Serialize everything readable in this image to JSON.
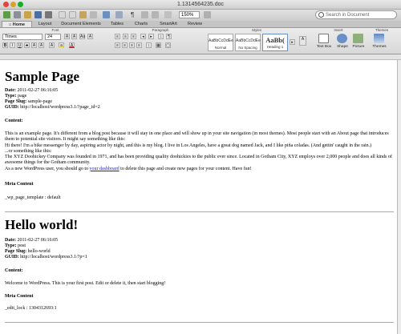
{
  "window": {
    "title": "1.1314564235.doc"
  },
  "toolbar": {
    "zoom": "150%",
    "search_placeholder": "Search in Document"
  },
  "tabs": [
    "Home",
    "Layout",
    "Document Elements",
    "Tables",
    "Charts",
    "SmartArt",
    "Review"
  ],
  "ribbon": {
    "groups": {
      "font": "Font",
      "paragraph": "Paragraph",
      "styles": "Styles",
      "insert": "Insert",
      "themes": "Themes"
    },
    "font_name": "Times",
    "font_size": "24",
    "style_items": [
      {
        "sample": "AaBbCcDdEe",
        "name": "Normal"
      },
      {
        "sample": "AaBbCcDdEe",
        "name": "No Spacing"
      },
      {
        "sample": "AaBb(",
        "name": "Heading 1"
      }
    ],
    "insert_items": [
      "Text Box",
      "Shape",
      "Picture"
    ],
    "themes_label": "Themes"
  },
  "document": {
    "post1": {
      "title": "Sample Page",
      "date_label": "Date:",
      "date": "2011-02-27 06:16:05",
      "type_label": "Type:",
      "type": "page",
      "slug_label": "Page Slug:",
      "slug": "sample-page",
      "guid_label": "GUID:",
      "guid": "http://localhost/wordpress3.1/?page_id=2",
      "content_label": "Content:",
      "p1": "This is an example page. It's different from a blog post because it will stay in one place and will show up in your site navigation (in most themes). Most people start with an About page that introduces them to potential site visitors. It might say something like this:",
      "p2": "Hi there! I'm a bike messenger by day, aspiring actor by night, and this is my blog. I live in Los Angeles, have a great dog named Jack, and I like piña coladas. (And gettin' caught in the rain.)",
      "p3": "...or something like this:",
      "p4": "The XYZ Doohickey Company was founded in 1971, and has been providing quality doohickies to the public ever since. Located in Gotham City, XYZ employs over 2,000 people and does all kinds of awesome things for the Gotham community.",
      "p5_before": "As a new WordPress user, you should go to ",
      "p5_link": "your dashboard",
      "p5_after": " to delete this page and create new pages for your content. Have fun!",
      "meta_label": "Meta Content",
      "meta_value": "_wp_page_template : default"
    },
    "post2": {
      "title": "Hello world!",
      "date_label": "Date:",
      "date": "2011-02-27 06:16:05",
      "type_label": "Type:",
      "type": "post",
      "slug_label": "Page Slug:",
      "slug": "hello-world",
      "guid_label": "GUID:",
      "guid": "http://localhost/wordpress3.1/?p=1",
      "content_label": "Content:",
      "p1": "Welcome to WordPress. This is your first post. Edit or delete it, then start blogging!",
      "meta_label": "Meta Content",
      "meta_value": "_edit_lock : 1304312693:1"
    }
  }
}
